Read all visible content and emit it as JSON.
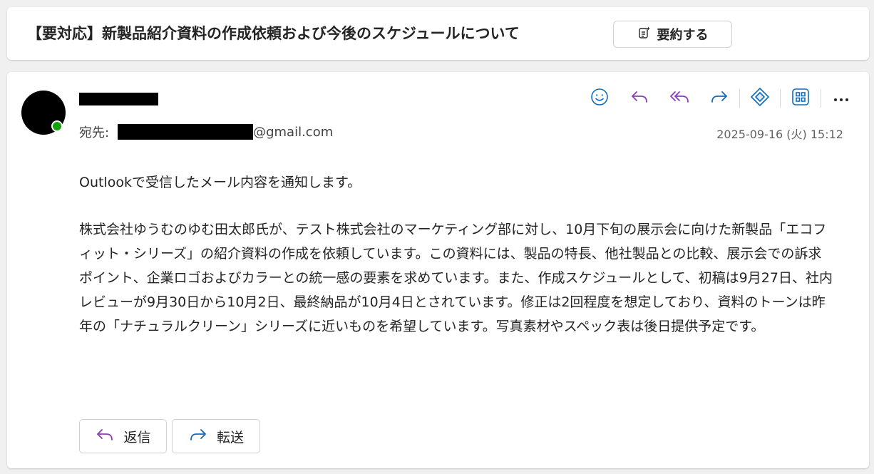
{
  "subject": {
    "text": "【要対応】新製品紹介資料の作成依頼および今後のスケジュールについて",
    "summarize_label": "要約する",
    "summarize_icon": "sparkle-document-icon"
  },
  "message": {
    "to_label": "宛先:",
    "to_domain": "@gmail.com",
    "date": "2025-09-16 (火) 15:12",
    "body": [
      "Outlookで受信したメール内容を通知します。",
      "株式会社ゆうむのゆむ田太郎氏が、テスト株式会社のマーケティング部に対し、10月下旬の展示会に向けた新製品「エコフィット・シリーズ」の紹介資料の作成を依頼しています。この資料には、製品の特長、他社製品との比較、展示会での訴求ポイント、企業ロゴおよびカラーとの統一感の要素を求めています。また、作成スケジュールとして、初稿は9月27日、社内レビューが9月30日から10月2日、最終納品が10月4日とされています。修正は2回程度を想定しており、資料のトーンは昨年の「ナチュラルクリーン」シリーズに近いものを希望しています。写真素材やスペック表は後日提供予定です。"
    ],
    "reply_label": "返信",
    "forward_label": "転送"
  },
  "toolbar": {
    "icons": [
      "emoji-icon",
      "reply-icon",
      "reply-all-icon",
      "forward-icon",
      "copilot-icon",
      "apps-icon",
      "more-icon"
    ]
  },
  "colors": {
    "accent_blue": "#0f6cbd",
    "reply_purple": "#8a3fb8",
    "presence_green": "#13a10e"
  }
}
